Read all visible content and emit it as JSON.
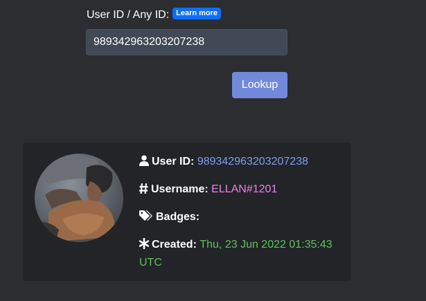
{
  "form": {
    "label": "User ID / Any ID:",
    "learn_more": "Learn more",
    "input_value": "989342963203207238",
    "lookup_label": "Lookup"
  },
  "result": {
    "user_id_label": "User ID",
    "user_id_value": "989342963203207238",
    "username_label": "Username",
    "username_value": "ELLAN#1201",
    "badges_label": "Badges",
    "created_label": "Created",
    "created_value": "Thu, 23 Jun 2022 01:35:43 UTC"
  },
  "icons": {
    "user": "user-icon",
    "username": "hashtag-icon",
    "badges": "tags-icon",
    "created": "asterisk-icon"
  },
  "colors": {
    "background": "#2b2d31",
    "card": "#222427",
    "input_bg": "#414956",
    "lookup_button": "#7289da",
    "learn_more_badge": "#0d6efd",
    "user_id_value": "#7f9ff5",
    "username_value": "#ee80ee",
    "created_value": "#5fc15f"
  }
}
